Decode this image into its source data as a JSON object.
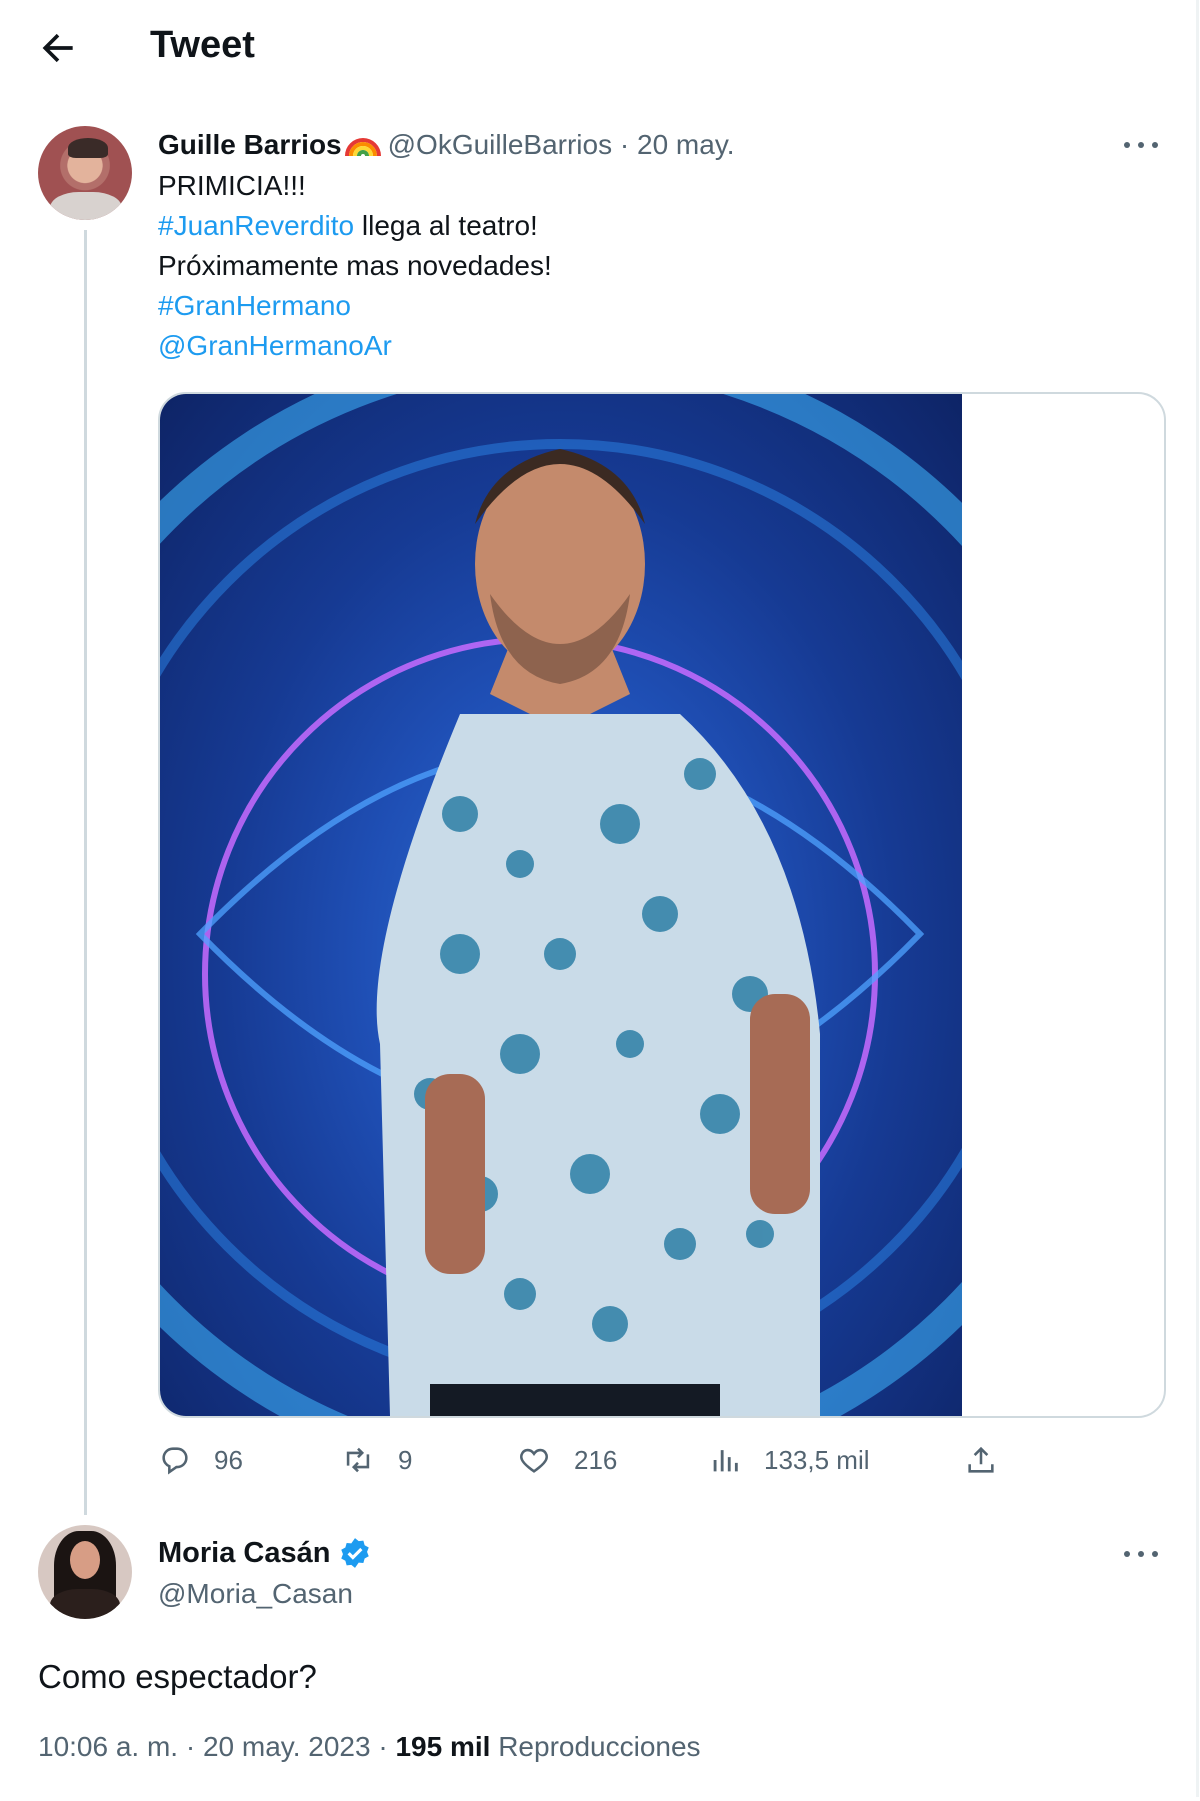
{
  "header": {
    "title": "Tweet"
  },
  "tweet": {
    "author_name": "Guille Barrios",
    "author_handle": "@OkGuilleBarrios",
    "separator": "·",
    "date": "20 may.",
    "lines": {
      "line1": "PRIMICIA!!!",
      "hashtag1": "#JuanReverdito",
      "line2_rest": " llega al teatro!",
      "line3": "Próximamente mas novedades!",
      "hashtag2": "#GranHermano",
      "mention": "@GranHermanoAr"
    },
    "stats": {
      "replies": "96",
      "retweets": "9",
      "likes": "216",
      "views": "133,5 mil"
    }
  },
  "reply": {
    "author_name": "Moria Casán",
    "author_handle": "@Moria_Casan",
    "text": "Como espectador?",
    "time": "10:06 a. m.",
    "separator1": " · ",
    "date": "20 may. 2023",
    "separator2": " · ",
    "views_count": "195 mil",
    "views_label": " Reproducciones"
  },
  "icons": [
    "back-arrow-icon",
    "rainbow-emoji-icon",
    "more-icon",
    "reply-icon",
    "retweet-icon",
    "like-icon",
    "views-icon",
    "share-icon",
    "verified-badge-icon"
  ],
  "colors": {
    "link": "#1d9bf0",
    "muted": "#536471",
    "text": "#0f1419",
    "verified": "#1d9bf0"
  }
}
